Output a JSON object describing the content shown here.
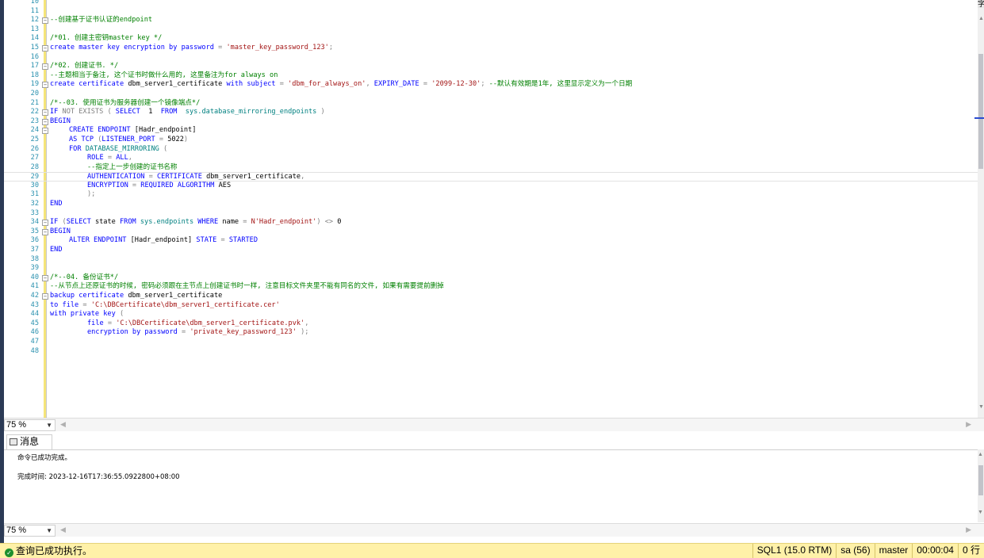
{
  "editor": {
    "lines": [
      {
        "n": "10",
        "fold": "",
        "indent": 0,
        "current": false,
        "tokens": []
      },
      {
        "n": "11",
        "fold": "",
        "indent": 0,
        "current": false,
        "tokens": []
      },
      {
        "n": "12",
        "fold": "⊟",
        "indent": 0,
        "current": false,
        "tokens": [
          {
            "c": "comment",
            "t": "--创建基于证书认证的endpoint"
          }
        ]
      },
      {
        "n": "13",
        "fold": "",
        "indent": 0,
        "current": false,
        "tokens": []
      },
      {
        "n": "14",
        "fold": "",
        "indent": 0,
        "current": false,
        "tokens": [
          {
            "c": "comment",
            "t": "/*01. 创建主密钥master key */"
          }
        ]
      },
      {
        "n": "15",
        "fold": "⊟",
        "indent": 0,
        "current": false,
        "tokens": [
          {
            "c": "keyword",
            "t": "create master key encryption by password "
          },
          {
            "c": "gray",
            "t": "= "
          },
          {
            "c": "string",
            "t": "'master_key_password_123'"
          },
          {
            "c": "gray",
            "t": ";"
          }
        ]
      },
      {
        "n": "16",
        "fold": "",
        "indent": 0,
        "current": false,
        "tokens": []
      },
      {
        "n": "17",
        "fold": "⊟",
        "indent": 0,
        "current": false,
        "tokens": [
          {
            "c": "comment",
            "t": "/*02. 创建证书. */"
          }
        ]
      },
      {
        "n": "18",
        "fold": "",
        "indent": 0,
        "current": false,
        "tokens": [
          {
            "c": "comment",
            "t": "--主题相当于备注, 这个证书时做什么用的, 这里备注为for always on"
          }
        ]
      },
      {
        "n": "19",
        "fold": "⊟",
        "indent": 0,
        "current": false,
        "tokens": [
          {
            "c": "keyword",
            "t": "create certificate "
          },
          {
            "c": "plain",
            "t": "dbm_server1_certificate "
          },
          {
            "c": "keyword",
            "t": "with subject "
          },
          {
            "c": "gray",
            "t": "= "
          },
          {
            "c": "string",
            "t": "'dbm_for_always_on'"
          },
          {
            "c": "gray",
            "t": ", "
          },
          {
            "c": "keyword",
            "t": "EXPIRY_DATE "
          },
          {
            "c": "gray",
            "t": "= "
          },
          {
            "c": "string",
            "t": "'2099-12-30'"
          },
          {
            "c": "gray",
            "t": "; "
          },
          {
            "c": "comment",
            "t": "--默认有效期是1年, 这里显示定义为一个日期"
          }
        ]
      },
      {
        "n": "20",
        "fold": "",
        "indent": 0,
        "current": false,
        "tokens": []
      },
      {
        "n": "21",
        "fold": "",
        "indent": 0,
        "current": false,
        "tokens": [
          {
            "c": "comment",
            "t": "/*--03. 使用证书为服务器创建一个镜像端点*/"
          }
        ]
      },
      {
        "n": "22",
        "fold": "⊟",
        "indent": 0,
        "current": false,
        "tokens": [
          {
            "c": "keyword",
            "t": "IF "
          },
          {
            "c": "gray",
            "t": "NOT EXISTS ( "
          },
          {
            "c": "keyword",
            "t": "SELECT  "
          },
          {
            "c": "plain",
            "t": "1  "
          },
          {
            "c": "keyword",
            "t": "FROM  "
          },
          {
            "c": "system",
            "t": "sys.database_mirroring_endpoints "
          },
          {
            "c": "gray",
            "t": ")"
          }
        ]
      },
      {
        "n": "23",
        "fold": "⊟",
        "indent": 0,
        "current": false,
        "tokens": [
          {
            "c": "keyword",
            "t": "BEGIN"
          }
        ]
      },
      {
        "n": "24",
        "fold": "⊟",
        "indent": 1,
        "current": false,
        "tokens": [
          {
            "c": "keyword",
            "t": "CREATE ENDPOINT "
          },
          {
            "c": "plain",
            "t": "[Hadr_endpoint]"
          }
        ]
      },
      {
        "n": "25",
        "fold": "",
        "indent": 1,
        "current": false,
        "tokens": [
          {
            "c": "keyword",
            "t": "AS TCP "
          },
          {
            "c": "gray",
            "t": "("
          },
          {
            "c": "keyword",
            "t": "LISTENER_PORT "
          },
          {
            "c": "gray",
            "t": "= "
          },
          {
            "c": "plain",
            "t": "5022"
          },
          {
            "c": "gray",
            "t": ")"
          }
        ]
      },
      {
        "n": "26",
        "fold": "",
        "indent": 1,
        "current": false,
        "tokens": [
          {
            "c": "keyword",
            "t": "FOR "
          },
          {
            "c": "system",
            "t": "DATABASE_MIRRORING "
          },
          {
            "c": "gray",
            "t": "("
          }
        ]
      },
      {
        "n": "27",
        "fold": "",
        "indent": 2,
        "current": false,
        "tokens": [
          {
            "c": "keyword",
            "t": "ROLE "
          },
          {
            "c": "gray",
            "t": "= "
          },
          {
            "c": "keyword",
            "t": "ALL"
          },
          {
            "c": "gray",
            "t": ","
          }
        ]
      },
      {
        "n": "28",
        "fold": "",
        "indent": 2,
        "current": false,
        "tokens": [
          {
            "c": "comment",
            "t": "--指定上一步创建的证书名称"
          }
        ]
      },
      {
        "n": "29",
        "fold": "",
        "indent": 2,
        "current": true,
        "tokens": [
          {
            "c": "keyword",
            "t": "AUTHENTICATION "
          },
          {
            "c": "gray",
            "t": "= "
          },
          {
            "c": "keyword",
            "t": "CERTIFICATE "
          },
          {
            "c": "plain",
            "t": "dbm_server1_certificate"
          },
          {
            "c": "gray",
            "t": ","
          }
        ]
      },
      {
        "n": "30",
        "fold": "",
        "indent": 2,
        "current": false,
        "tokens": [
          {
            "c": "keyword",
            "t": "ENCRYPTION "
          },
          {
            "c": "gray",
            "t": "= "
          },
          {
            "c": "keyword",
            "t": "REQUIRED ALGORITHM "
          },
          {
            "c": "plain",
            "t": "AES"
          }
        ]
      },
      {
        "n": "31",
        "fold": "",
        "indent": 2,
        "current": false,
        "tokens": [
          {
            "c": "gray",
            "t": ");"
          }
        ]
      },
      {
        "n": "32",
        "fold": "",
        "indent": 0,
        "current": false,
        "tokens": [
          {
            "c": "keyword",
            "t": "END"
          }
        ]
      },
      {
        "n": "33",
        "fold": "",
        "indent": 0,
        "current": false,
        "tokens": []
      },
      {
        "n": "34",
        "fold": "⊟",
        "indent": 0,
        "current": false,
        "tokens": [
          {
            "c": "keyword",
            "t": "IF "
          },
          {
            "c": "gray",
            "t": "("
          },
          {
            "c": "keyword",
            "t": "SELECT "
          },
          {
            "c": "plain",
            "t": "state "
          },
          {
            "c": "keyword",
            "t": "FROM "
          },
          {
            "c": "system",
            "t": "sys.endpoints "
          },
          {
            "c": "keyword",
            "t": "WHERE "
          },
          {
            "c": "plain",
            "t": "name "
          },
          {
            "c": "gray",
            "t": "= "
          },
          {
            "c": "string",
            "t": "N'Hadr_endpoint'"
          },
          {
            "c": "gray",
            "t": ") <> "
          },
          {
            "c": "plain",
            "t": "0"
          }
        ]
      },
      {
        "n": "35",
        "fold": "⊟",
        "indent": 0,
        "current": false,
        "tokens": [
          {
            "c": "keyword",
            "t": "BEGIN"
          }
        ]
      },
      {
        "n": "36",
        "fold": "",
        "indent": 1,
        "current": false,
        "tokens": [
          {
            "c": "keyword",
            "t": "ALTER ENDPOINT "
          },
          {
            "c": "plain",
            "t": "[Hadr_endpoint] "
          },
          {
            "c": "keyword",
            "t": "STATE "
          },
          {
            "c": "gray",
            "t": "= "
          },
          {
            "c": "keyword",
            "t": "STARTED"
          }
        ]
      },
      {
        "n": "37",
        "fold": "",
        "indent": 0,
        "current": false,
        "tokens": [
          {
            "c": "keyword",
            "t": "END"
          }
        ]
      },
      {
        "n": "38",
        "fold": "",
        "indent": 0,
        "current": false,
        "tokens": []
      },
      {
        "n": "39",
        "fold": "",
        "indent": 0,
        "current": false,
        "tokens": []
      },
      {
        "n": "40",
        "fold": "⊟",
        "indent": 0,
        "current": false,
        "tokens": [
          {
            "c": "comment",
            "t": "/*--04. 备份证书*/"
          }
        ]
      },
      {
        "n": "41",
        "fold": "",
        "indent": 0,
        "current": false,
        "tokens": [
          {
            "c": "comment",
            "t": "--从节点上还原证书的时候, 密码必须跟在主节点上创建证书时一样, 注意目标文件夹里不能有同名的文件, 如果有需要提前删掉"
          }
        ]
      },
      {
        "n": "42",
        "fold": "⊟",
        "indent": 0,
        "current": false,
        "tokens": [
          {
            "c": "keyword",
            "t": "backup certificate "
          },
          {
            "c": "plain",
            "t": "dbm_server1_certificate"
          }
        ]
      },
      {
        "n": "43",
        "fold": "",
        "indent": 0,
        "current": false,
        "tokens": [
          {
            "c": "keyword",
            "t": "to file "
          },
          {
            "c": "gray",
            "t": "= "
          },
          {
            "c": "string",
            "t": "'C:\\DBCertificate\\dbm_server1_certificate.cer'"
          }
        ]
      },
      {
        "n": "44",
        "fold": "",
        "indent": 0,
        "current": false,
        "tokens": [
          {
            "c": "keyword",
            "t": "with private key "
          },
          {
            "c": "gray",
            "t": "("
          }
        ]
      },
      {
        "n": "45",
        "fold": "",
        "indent": 2,
        "current": false,
        "tokens": [
          {
            "c": "keyword",
            "t": "file "
          },
          {
            "c": "gray",
            "t": "= "
          },
          {
            "c": "string",
            "t": "'C:\\DBCertificate\\dbm_server1_certificate.pvk'"
          },
          {
            "c": "gray",
            "t": ","
          }
        ]
      },
      {
        "n": "46",
        "fold": "",
        "indent": 2,
        "current": false,
        "tokens": [
          {
            "c": "keyword",
            "t": "encryption by password "
          },
          {
            "c": "gray",
            "t": "= "
          },
          {
            "c": "string",
            "t": "'private_key_password_123' "
          },
          {
            "c": "gray",
            "t": ");"
          }
        ]
      },
      {
        "n": "47",
        "fold": "",
        "indent": 0,
        "current": false,
        "tokens": []
      },
      {
        "n": "48",
        "fold": "",
        "indent": 0,
        "current": false,
        "tokens": []
      }
    ],
    "corner_char": "字"
  },
  "editor_zoom": {
    "value": "75 %"
  },
  "messages_tab": {
    "label": "消息"
  },
  "messages": {
    "line1": "命令已成功完成。",
    "line2": "完成时间: 2023-12-16T17:36:55.0922800+08:00"
  },
  "messages_zoom": {
    "value": "75 %"
  },
  "statusbar": {
    "message": "查询已成功执行。",
    "server": "SQL1 (15.0 RTM)",
    "user": "sa (56)",
    "database": "master",
    "elapsed": "00:00:04",
    "rows": "0 行"
  },
  "colors": {
    "statusbar_bg": "#fff1a8",
    "keyword": "#0000ff",
    "string": "#a31515",
    "comment": "#008000",
    "system": "#008080"
  }
}
